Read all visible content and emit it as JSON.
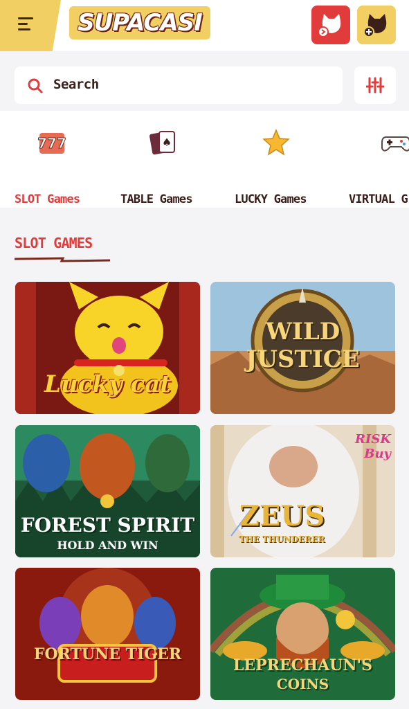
{
  "header": {
    "logo_text": "SUPACASI",
    "menu_icon": "hamburger-icon",
    "login_icon": "cat-login-icon",
    "register_icon": "cat-register-icon"
  },
  "search": {
    "placeholder": "Search",
    "icon": "search-icon",
    "filter_icon": "sliders-icon"
  },
  "categories": [
    {
      "label": "SLOT Games",
      "icon": "slot-777-icon",
      "active": true
    },
    {
      "label": "TABLE Games",
      "icon": "playing-cards-icon",
      "active": false
    },
    {
      "label": "LUCKY Games",
      "icon": "star-icon",
      "active": false
    },
    {
      "label": "VIRTUAL G",
      "icon": "gamepad-icon",
      "active": false
    }
  ],
  "section": {
    "title": "SLOT GAMES"
  },
  "games": [
    {
      "title": "Lucky cat",
      "subtitle": ""
    },
    {
      "title": "WILD JUSTICE",
      "subtitle": ""
    },
    {
      "title": "FOREST SPIRIT",
      "subtitle": "HOLD AND WIN"
    },
    {
      "title": "ZEUS",
      "subtitle": "THE THUNDERER",
      "badge": "RISK Buy"
    },
    {
      "title": "FORTUNE TIGER",
      "subtitle": ""
    },
    {
      "title": "LEPRECHAUN'S",
      "subtitle": "COINS"
    }
  ],
  "colors": {
    "accent_red": "#e23b3b",
    "gold": "#f2cf63",
    "dark_text": "#3a1f1a",
    "background": "#f4f4f7"
  }
}
